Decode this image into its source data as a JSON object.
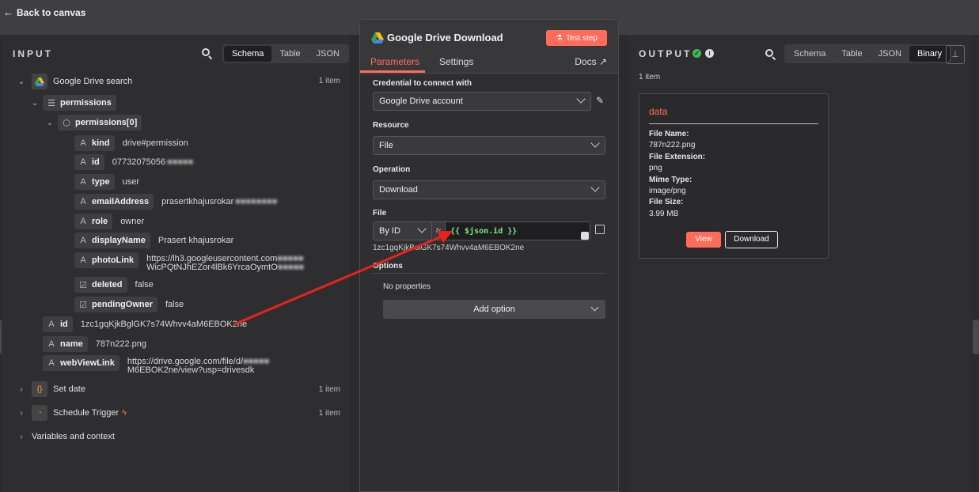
{
  "topbar": {
    "back_label": "Back to canvas"
  },
  "input": {
    "title": "INPUT",
    "view_tabs": [
      "Schema",
      "Table",
      "JSON"
    ],
    "active_tab": "Schema",
    "nodes": {
      "gdrive_search": {
        "label": "Google Drive search",
        "count": "1 item"
      },
      "permissions": "permissions",
      "permissions0": "permissions[0]",
      "fields": [
        {
          "key": "kind",
          "value": "drive#permission"
        },
        {
          "key": "id",
          "value": "07732075056"
        },
        {
          "key": "type",
          "value": "user"
        },
        {
          "key": "emailAddress",
          "value": "prasertkhajusrokar"
        },
        {
          "key": "role",
          "value": "owner"
        },
        {
          "key": "displayName",
          "value": "Prasert khajusrokar"
        },
        {
          "key": "photoLink",
          "value": "https://lh3.googleusercontent.com",
          "value2": "WicPQtNJhEZor4lBk6YrcaOymtO"
        },
        {
          "key": "deleted",
          "value": "false"
        },
        {
          "key": "pendingOwner",
          "value": "false"
        }
      ],
      "id": {
        "key": "id",
        "value": "1zc1gqKjkBglGK7s74Whvv4aM6EBOK2ne"
      },
      "name": {
        "key": "name",
        "value": "787n222.png"
      },
      "webViewLink": {
        "key": "webViewLink",
        "value": "https://drive.google.com/file/d/",
        "value2": "M6EBOK2ne/view?usp=drivesdk"
      },
      "set_date": {
        "label": "Set date",
        "count": "1 item"
      },
      "schedule": {
        "label": "Schedule Trigger",
        "count": "1 item"
      },
      "variables": {
        "label": "Variables and context"
      }
    }
  },
  "modal": {
    "title": "Google Drive Download",
    "test_step": "Test step",
    "tabs": {
      "parameters": "Parameters",
      "settings": "Settings",
      "docs": "Docs"
    },
    "credential": {
      "label": "Credential to connect with",
      "value": "Google Drive account"
    },
    "resource": {
      "label": "Resource",
      "value": "File"
    },
    "operation": {
      "label": "Operation",
      "value": "Download"
    },
    "file": {
      "label": "File",
      "mode": "By ID",
      "expression": "{{ $json.id }}",
      "resolved": "1zc1gqKjkBolGK7s74Whvv4aM6EBOK2ne"
    },
    "options": {
      "label": "Options",
      "none": "No properties",
      "add_option": "Add option"
    }
  },
  "output": {
    "title": "OUTPUT",
    "view_tabs": [
      "Schema",
      "Table",
      "JSON",
      "Binary"
    ],
    "active_tab": "Binary",
    "count": "1 item",
    "card": {
      "title": "data",
      "file_name_label": "File Name:",
      "file_name": "787n222.png",
      "ext_label": "File Extension:",
      "ext": "png",
      "mime_label": "Mime Type:",
      "mime": "image/png",
      "size_label": "File Size:",
      "size": "3.99 MB",
      "view": "View",
      "download": "Download"
    }
  },
  "colors": {
    "accent": "#ff6d5a",
    "success": "#3fb950",
    "expression": "#7ee787"
  }
}
